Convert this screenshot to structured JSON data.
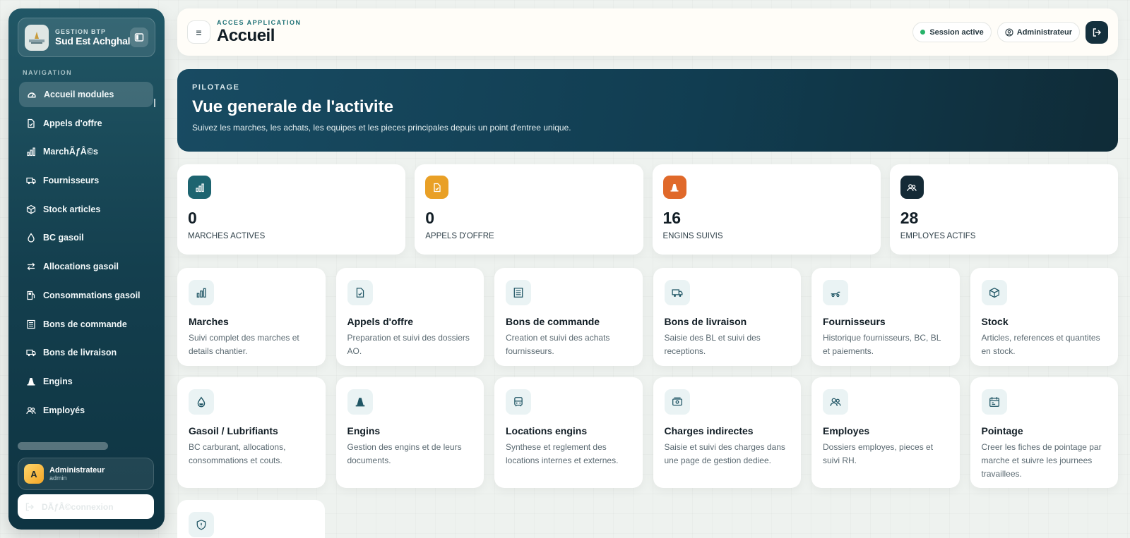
{
  "sidebar": {
    "brand_sub": "GESTION BTP",
    "brand_name": "Sud Est Achghal",
    "nav_heading": "NAVIGATION",
    "items": [
      {
        "label": "Accueil modules",
        "icon": "dashboard-icon",
        "active": true
      },
      {
        "label": "Appels d'offre",
        "icon": "document-check-icon"
      },
      {
        "label": "MarchÃƒÂ©s",
        "icon": "chart-bars-icon"
      },
      {
        "label": "Fournisseurs",
        "icon": "truck-icon"
      },
      {
        "label": "Stock articles",
        "icon": "box-icon"
      },
      {
        "label": "BC gasoil",
        "icon": "droplet-icon"
      },
      {
        "label": "Allocations gasoil",
        "icon": "arrows-exchange-icon"
      },
      {
        "label": "Consommations gasoil",
        "icon": "fuel-pump-icon"
      },
      {
        "label": "Bons de commande",
        "icon": "list-document-icon"
      },
      {
        "label": "Bons de livraison",
        "icon": "truck-icon"
      },
      {
        "label": "Engins",
        "icon": "cone-icon"
      },
      {
        "label": "Employés",
        "icon": "users-icon"
      }
    ],
    "user": {
      "initial": "A",
      "name": "Administrateur",
      "role": "admin"
    },
    "logout_label": "DÃƒÂ©connexion"
  },
  "topbar": {
    "eyebrow": "ACCES APPLICATION",
    "title": "Accueil",
    "session": "Session active",
    "user": "Administrateur"
  },
  "hero": {
    "eyebrow": "PILOTAGE",
    "title": "Vue generale de l'activite",
    "description": "Suivez les marches, les achats, les equipes et les pieces principales depuis un point d'entree unique."
  },
  "stats": [
    {
      "value": "0",
      "label": "MARCHES ACTIVES",
      "icon": "chart-bars-icon",
      "color": "#1d6470"
    },
    {
      "value": "0",
      "label": "APPELS D'OFFRE",
      "icon": "document-check-icon",
      "color": "#e9a026"
    },
    {
      "value": "16",
      "label": "ENGINS SUIVIS",
      "icon": "cone-icon",
      "color": "#e0692a"
    },
    {
      "value": "28",
      "label": "EMPLOYES ACTIFS",
      "icon": "users-icon",
      "color": "#142a36"
    }
  ],
  "modules": [
    {
      "title": "Marches",
      "desc": "Suivi complet des marches et details chantier.",
      "icon": "chart-bars-icon"
    },
    {
      "title": "Appels d'offre",
      "desc": "Preparation et suivi des dossiers AO.",
      "icon": "document-check-icon"
    },
    {
      "title": "Bons de commande",
      "desc": "Creation et suivi des achats fournisseurs.",
      "icon": "list-document-icon"
    },
    {
      "title": "Bons de livraison",
      "desc": "Saisie des BL et suivi des receptions.",
      "icon": "truck-icon"
    },
    {
      "title": "Fournisseurs",
      "desc": "Historique fournisseurs, BC, BL et paiements.",
      "icon": "delivery-icon"
    },
    {
      "title": "Stock",
      "desc": "Articles, references et quantites en stock.",
      "icon": "box-icon"
    },
    {
      "title": "Gasoil / Lubrifiants",
      "desc": "BC carburant, allocations, consommations et couts.",
      "icon": "droplet-icon"
    },
    {
      "title": "Engins",
      "desc": "Gestion des engins et de leurs documents.",
      "icon": "cone-icon"
    },
    {
      "title": "Locations engins",
      "desc": "Synthese et reglement des locations internes et externes.",
      "icon": "bus-icon"
    },
    {
      "title": "Charges indirectes",
      "desc": "Saisie et suivi des charges dans une page de gestion dediee.",
      "icon": "cash-icon"
    },
    {
      "title": "Employes",
      "desc": "Dossiers employes, pieces et suivi RH.",
      "icon": "users-icon"
    },
    {
      "title": "Pointage",
      "desc": "Creer les fiches de pointage par marche et suivre les journees travaillees.",
      "icon": "calendar-icon"
    }
  ],
  "extra_module": {
    "icon": "shield-icon"
  }
}
